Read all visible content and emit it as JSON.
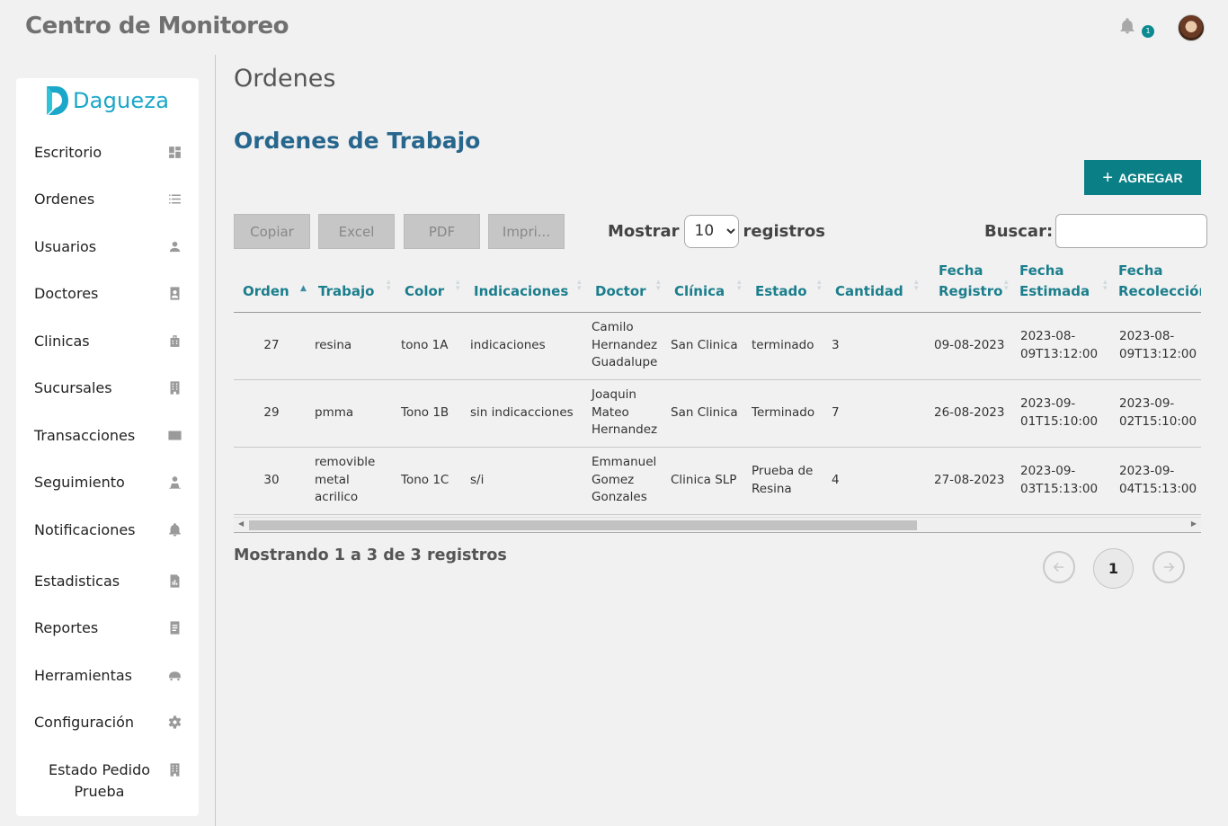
{
  "header": {
    "app_title": "Centro de Monitoreo",
    "notification_count": "1"
  },
  "sidebar": {
    "brand": "Dagueza",
    "items": [
      {
        "label": "Escritorio",
        "icon": "dashboard-icon"
      },
      {
        "label": "Ordenes",
        "icon": "list-icon"
      },
      {
        "label": "Usuarios",
        "icon": "user-icon"
      },
      {
        "label": "Doctores",
        "icon": "doctor-badge-icon"
      },
      {
        "label": "Clinicas",
        "icon": "clinic-icon"
      },
      {
        "label": "Sucursales",
        "icon": "building-icon"
      },
      {
        "label": "Transacciones",
        "icon": "wallet-icon"
      },
      {
        "label": "Seguimiento",
        "icon": "tracking-user-icon"
      },
      {
        "label": "Notificaciones",
        "icon": "bell-icon"
      },
      {
        "label": "Estadisticas",
        "icon": "chart-file-icon"
      },
      {
        "label": "Reportes",
        "icon": "document-icon"
      },
      {
        "label": "Herramientas",
        "icon": "tools-icon"
      },
      {
        "label": "Configuración",
        "icon": "gear-icon"
      },
      {
        "label": "Estado Pedido Prueba",
        "icon": "building-icon"
      }
    ]
  },
  "main": {
    "page_title": "Ordenes",
    "section_title": "Ordenes de Trabajo",
    "add_button": "AGREGAR",
    "export_buttons": {
      "copy": "Copiar",
      "excel": "Excel",
      "pdf": "PDF",
      "print": "Impri..."
    },
    "length": {
      "prefix": "Mostrar",
      "value": "10",
      "suffix": "registros"
    },
    "search_label": "Buscar:",
    "search_value": "",
    "table": {
      "headers": [
        "Orden",
        "Trabajo",
        "Color",
        "Indicaciones",
        "Doctor",
        "Clínica",
        "Estado",
        "Cantidad",
        "Fecha Registro",
        "Fecha Estimada",
        "Fecha Recolección"
      ],
      "rows": [
        [
          "27",
          "resina",
          "tono 1A",
          "indicaciones",
          "Camilo Hernandez Guadalupe",
          "San Clinica",
          "terminado",
          "3",
          "09-08-2023",
          "2023-08-09T13:12:00",
          "2023-08-09T13:12:00"
        ],
        [
          "29",
          "pmma",
          "Tono 1B",
          "sin indicacciones",
          "Joaquin Mateo Hernandez",
          "San Clinica",
          "Terminado",
          "7",
          "26-08-2023",
          "2023-09-01T15:10:00",
          "2023-09-02T15:10:00"
        ],
        [
          "30",
          "removible metal acrilico",
          "Tono 1C",
          "s/i",
          "Emmanuel Gomez Gonzales",
          "Clinica SLP",
          "Prueba de Resina",
          "4",
          "27-08-2023",
          "2023-09-03T15:13:00",
          "2023-09-04T15:13:00"
        ]
      ]
    },
    "info": "Mostrando 1 a 3 de 3 registros",
    "pagination": {
      "current": "1"
    }
  }
}
